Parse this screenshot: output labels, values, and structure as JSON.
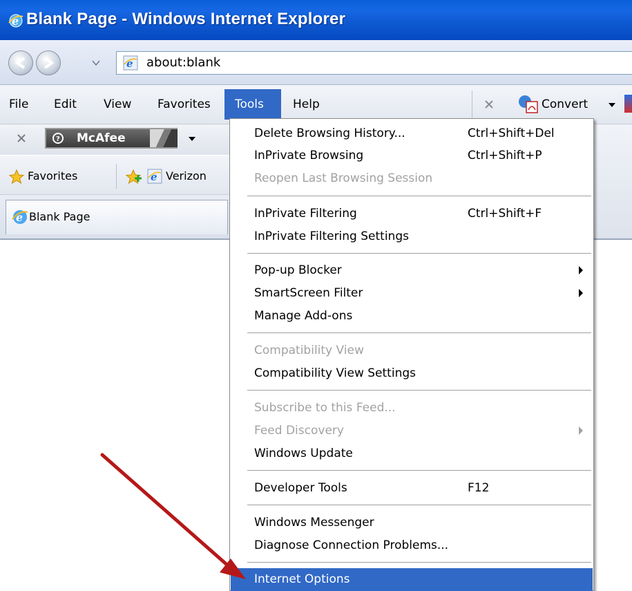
{
  "window": {
    "title": "Blank Page - Windows Internet Explorer"
  },
  "address": {
    "url": "about:blank"
  },
  "menubar": {
    "items": [
      "File",
      "Edit",
      "View",
      "Favorites",
      "Tools",
      "Help"
    ],
    "active": "Tools",
    "convert_label": "Convert"
  },
  "toolbar": {
    "mcafee_label": "McAfee"
  },
  "favorites_bar": {
    "favorites_label": "Favorites",
    "link_label": "Verizon"
  },
  "tab": {
    "title": "Blank Page"
  },
  "tools_menu": {
    "items": [
      {
        "label": "Delete Browsing History...",
        "shortcut": "Ctrl+Shift+Del",
        "enabled": true
      },
      {
        "label": "InPrivate Browsing",
        "shortcut": "Ctrl+Shift+P",
        "enabled": true
      },
      {
        "label": "Reopen Last Browsing Session",
        "shortcut": "",
        "enabled": false
      },
      {
        "label": "InPrivate Filtering",
        "shortcut": "Ctrl+Shift+F",
        "enabled": true
      },
      {
        "label": "InPrivate Filtering Settings",
        "shortcut": "",
        "enabled": true
      },
      {
        "label": "Pop-up Blocker",
        "shortcut": "",
        "enabled": true,
        "submenu": true
      },
      {
        "label": "SmartScreen Filter",
        "shortcut": "",
        "enabled": true,
        "submenu": true
      },
      {
        "label": "Manage Add-ons",
        "shortcut": "",
        "enabled": true
      },
      {
        "label": "Compatibility View",
        "shortcut": "",
        "enabled": false
      },
      {
        "label": "Compatibility View Settings",
        "shortcut": "",
        "enabled": true
      },
      {
        "label": "Subscribe to this Feed...",
        "shortcut": "",
        "enabled": false
      },
      {
        "label": "Feed Discovery",
        "shortcut": "",
        "enabled": false,
        "submenu": true
      },
      {
        "label": "Windows Update",
        "shortcut": "",
        "enabled": true
      },
      {
        "label": "Developer Tools",
        "shortcut": "F12",
        "enabled": true
      },
      {
        "label": "Windows Messenger",
        "shortcut": "",
        "enabled": true
      },
      {
        "label": "Diagnose Connection Problems...",
        "shortcut": "",
        "enabled": true
      },
      {
        "label": "Internet Options",
        "shortcut": "",
        "enabled": true,
        "highlighted": true
      }
    ]
  },
  "colors": {
    "titlebar": "#0a5ed8",
    "highlight": "#3169c6",
    "arrow": "#b51818"
  },
  "icons": [
    "ie-logo-icon",
    "back-icon",
    "forward-icon",
    "ie-page-icon",
    "close-icon",
    "mcafee-icon",
    "dropdown-arrow-icon",
    "favorites-star-icon",
    "add-favorites-icon",
    "convert-pdf-icon",
    "red-arrow-annotation"
  ]
}
